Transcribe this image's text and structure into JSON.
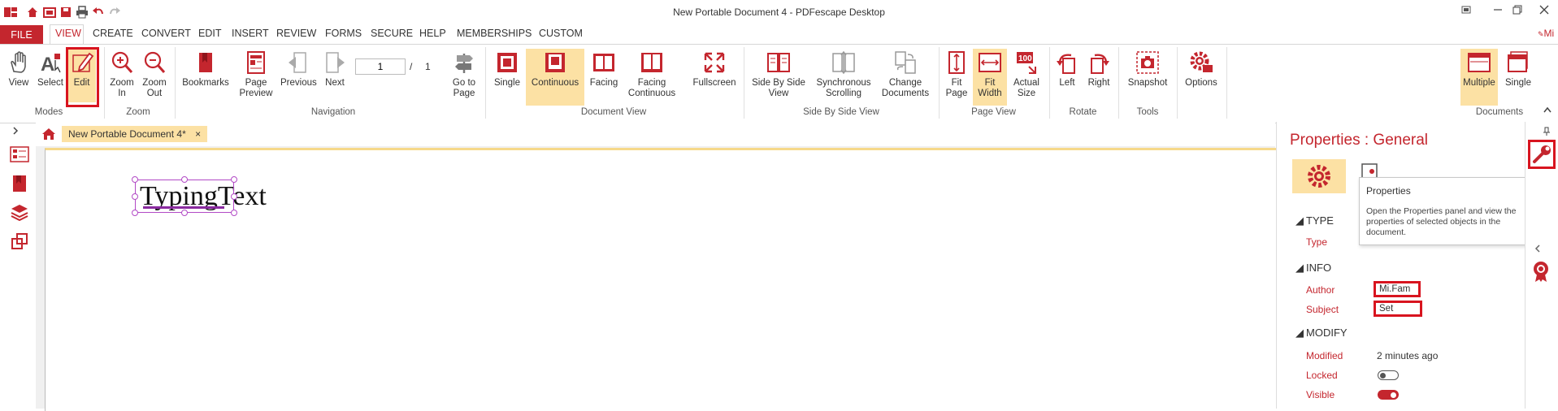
{
  "window": {
    "title": "New Portable Document 4    -    PDFescape Desktop",
    "user": "Mi"
  },
  "menu": {
    "file": "FILE",
    "items": [
      "VIEW",
      "CREATE",
      "CONVERT",
      "EDIT",
      "INSERT",
      "REVIEW",
      "FORMS",
      "SECURE",
      "HELP",
      "MEMBERSHIPS",
      "CUSTOM"
    ]
  },
  "ribbon": {
    "modes": {
      "label": "Modes",
      "view": "View",
      "select": "Select",
      "edit": "Edit"
    },
    "zoom": {
      "label": "Zoom",
      "zoom_in_1": "Zoom",
      "zoom_in_2": "In",
      "zoom_out_1": "Zoom",
      "zoom_out_2": "Out"
    },
    "navigation": {
      "label": "Navigation",
      "bookmarks": "Bookmarks",
      "page_preview_1": "Page",
      "page_preview_2": "Preview",
      "previous": "Previous",
      "next": "Next",
      "page_value": "1",
      "page_sep": "/",
      "page_total": "1",
      "goto_1": "Go to",
      "goto_2": "Page"
    },
    "document_view": {
      "label": "Document View",
      "single": "Single",
      "continuous": "Continuous",
      "facing": "Facing",
      "facing_cont_1": "Facing",
      "facing_cont_2": "Continuous",
      "fullscreen": "Fullscreen"
    },
    "side_by_side": {
      "label": "Side By Side View",
      "sbs_1": "Side By Side",
      "sbs_2": "View",
      "sync_1": "Synchronous",
      "sync_2": "Scrolling",
      "change_1": "Change",
      "change_2": "Documents"
    },
    "page_view": {
      "label": "Page View",
      "fit_page_1": "Fit",
      "fit_page_2": "Page",
      "fit_width_1": "Fit",
      "fit_width_2": "Width",
      "actual_1": "Actual",
      "actual_2": "Size"
    },
    "rotate": {
      "label": "Rotate",
      "left": "Left",
      "right": "Right"
    },
    "tools": {
      "label": "Tools",
      "snapshot": "Snapshot"
    },
    "options": "Options",
    "documents": {
      "label": "Documents",
      "multiple": "Multiple",
      "single": "Single"
    }
  },
  "document": {
    "tab_label": "New Portable Document 4*",
    "tab_close": "×",
    "text_selected": "Typing",
    "text_rest": "Text"
  },
  "properties": {
    "title": "Properties : General",
    "type_section": "TYPE",
    "type_label": "Type",
    "info_section": "INFO",
    "author_label": "Author",
    "author_value": "Mi.Fam",
    "subject_label": "Subject",
    "subject_value": "Set",
    "modify_section": "MODIFY",
    "modified_label": "Modified",
    "modified_value": "2 minutes ago",
    "locked_label": "Locked",
    "locked": false,
    "visible_label": "Visible",
    "visible": true
  },
  "tooltip": {
    "title": "Properties",
    "body": "Open the Properties panel and view the properties of selected objects in the document."
  },
  "colors": {
    "accent": "#c4262e",
    "highlight": "#fce1a4",
    "annotation": "#d8141f"
  }
}
